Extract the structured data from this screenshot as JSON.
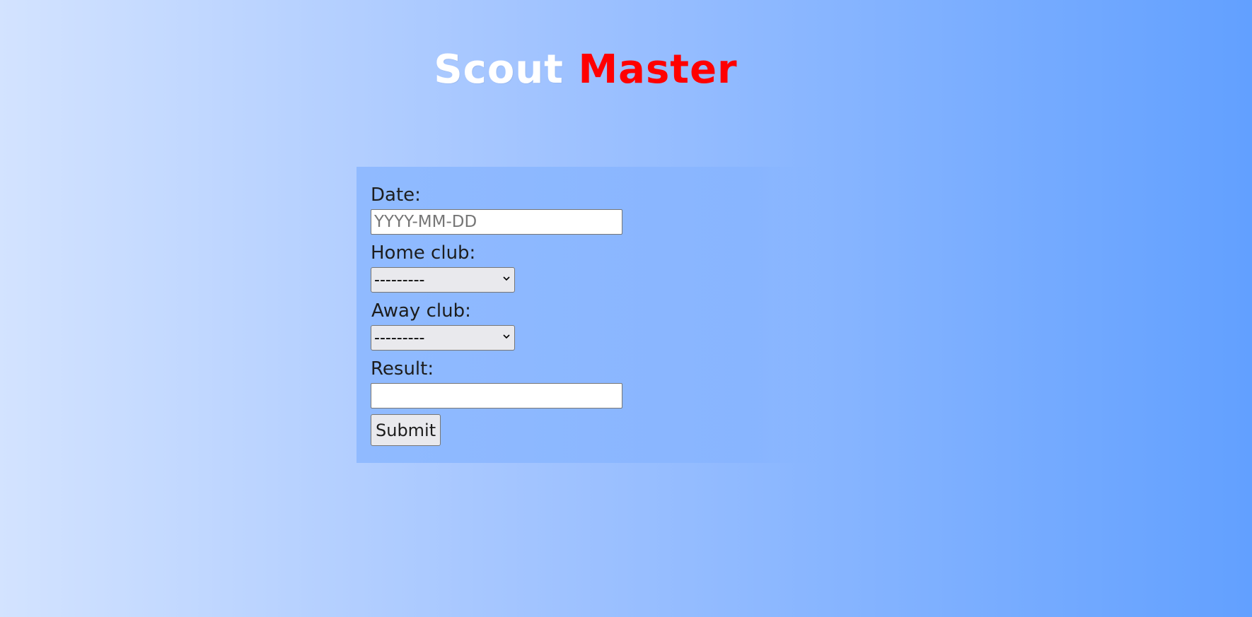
{
  "header": {
    "logo_part_1": "Scout",
    "logo_part_2": "Master"
  },
  "form": {
    "date_label": "Date:",
    "date_placeholder": "YYYY-MM-DD",
    "date_value": "",
    "home_label": "Home club:",
    "home_selected": "---------",
    "away_label": "Away club:",
    "away_selected": "---------",
    "result_label": "Result:",
    "result_value": "",
    "submit_label": "Submit"
  },
  "icons": {
    "select_arrow": "chevron-down-icon"
  },
  "colors": {
    "logo_primary": "#ffffff",
    "logo_accent": "#ff0000",
    "background_start": "#d3e3ff",
    "background_end": "#62a0ff",
    "panel": "#87b4ff"
  }
}
